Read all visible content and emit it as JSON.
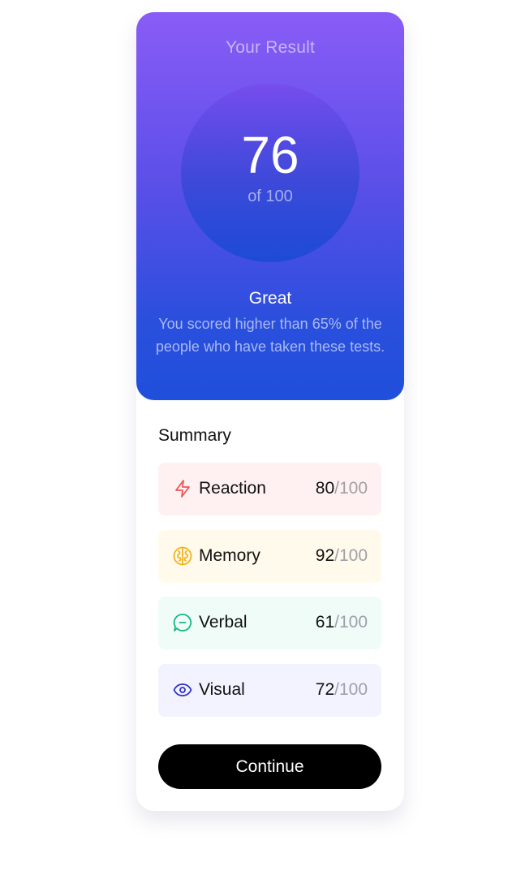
{
  "result": {
    "title": "Your Result",
    "score": "76",
    "total": "of 100",
    "grade": "Great",
    "description": "You scored higher than 65% of the people who have taken these tests."
  },
  "summary": {
    "title": "Summary",
    "items": [
      {
        "label": "Reaction",
        "score": "80",
        "max": "/100",
        "icon": "lightning-icon",
        "color": "#f05454",
        "bg": "#fff1f1"
      },
      {
        "label": "Memory",
        "score": "92",
        "max": "/100",
        "icon": "brain-icon",
        "color": "#f3b21b",
        "bg": "#fffaeb"
      },
      {
        "label": "Verbal",
        "score": "61",
        "max": "/100",
        "icon": "chat-bubble-icon",
        "color": "#12b886",
        "bg": "#effcf7"
      },
      {
        "label": "Visual",
        "score": "72",
        "max": "/100",
        "icon": "eye-icon",
        "color": "#2f30c9",
        "bg": "#f3f2ff"
      }
    ]
  },
  "actions": {
    "continue_label": "Continue"
  },
  "colors": {
    "gradient_top": "#8a5cf6",
    "gradient_bottom": "#1f4fdb",
    "button": "#000000"
  }
}
